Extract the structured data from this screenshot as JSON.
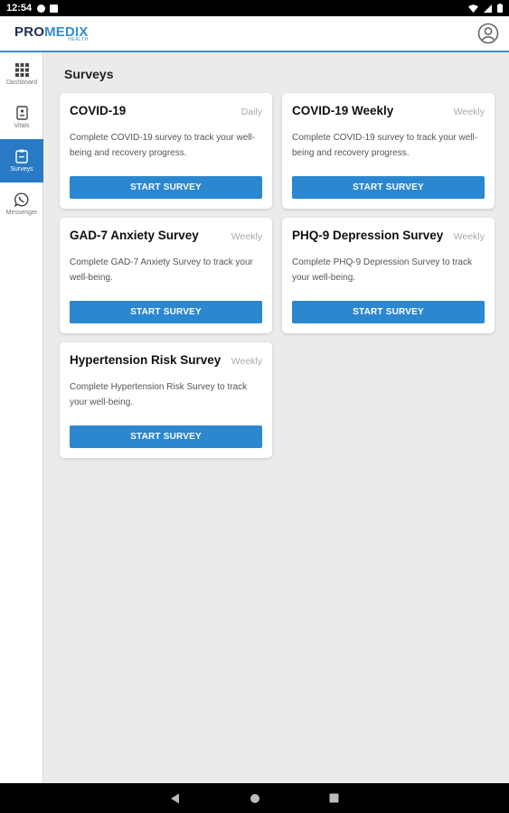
{
  "status_bar": {
    "time": "12:54"
  },
  "app": {
    "logo_pro": "PRO",
    "logo_medix": "MEDIX",
    "logo_sub": "HEALTH",
    "accent_color": "#2b87cf"
  },
  "sidebar": {
    "items": [
      {
        "label": "Dashboard",
        "icon": "grid-icon",
        "active": false
      },
      {
        "label": "Vitals",
        "icon": "vitals-icon",
        "active": false
      },
      {
        "label": "Surveys",
        "icon": "clipboard-icon",
        "active": true
      },
      {
        "label": "Messenger",
        "icon": "chat-icon",
        "active": false
      }
    ]
  },
  "main": {
    "title": "Surveys",
    "cards": [
      {
        "title": "COVID-19",
        "frequency": "Daily",
        "description": "Complete COVID-19 survey to track your well-being and recovery progress.",
        "button": "START SURVEY"
      },
      {
        "title": "COVID-19 Weekly",
        "frequency": "Weekly",
        "description": "Complete COVID-19 survey to track your well-being and recovery progress.",
        "button": "START SURVEY"
      },
      {
        "title": "GAD-7 Anxiety Survey",
        "frequency": "Weekly",
        "description": "Complete GAD-7 Anxiety Survey to track your well-being.",
        "button": "START SURVEY"
      },
      {
        "title": "PHQ-9 Depression Survey",
        "frequency": "Weekly",
        "description": "Complete PHQ-9 Depression Survey to track your well-being.",
        "button": "START SURVEY"
      },
      {
        "title": "Hypertension Risk Survey",
        "frequency": "Weekly",
        "description": "Complete Hypertension Risk Survey to track your well-being.",
        "button": "START SURVEY"
      }
    ]
  }
}
